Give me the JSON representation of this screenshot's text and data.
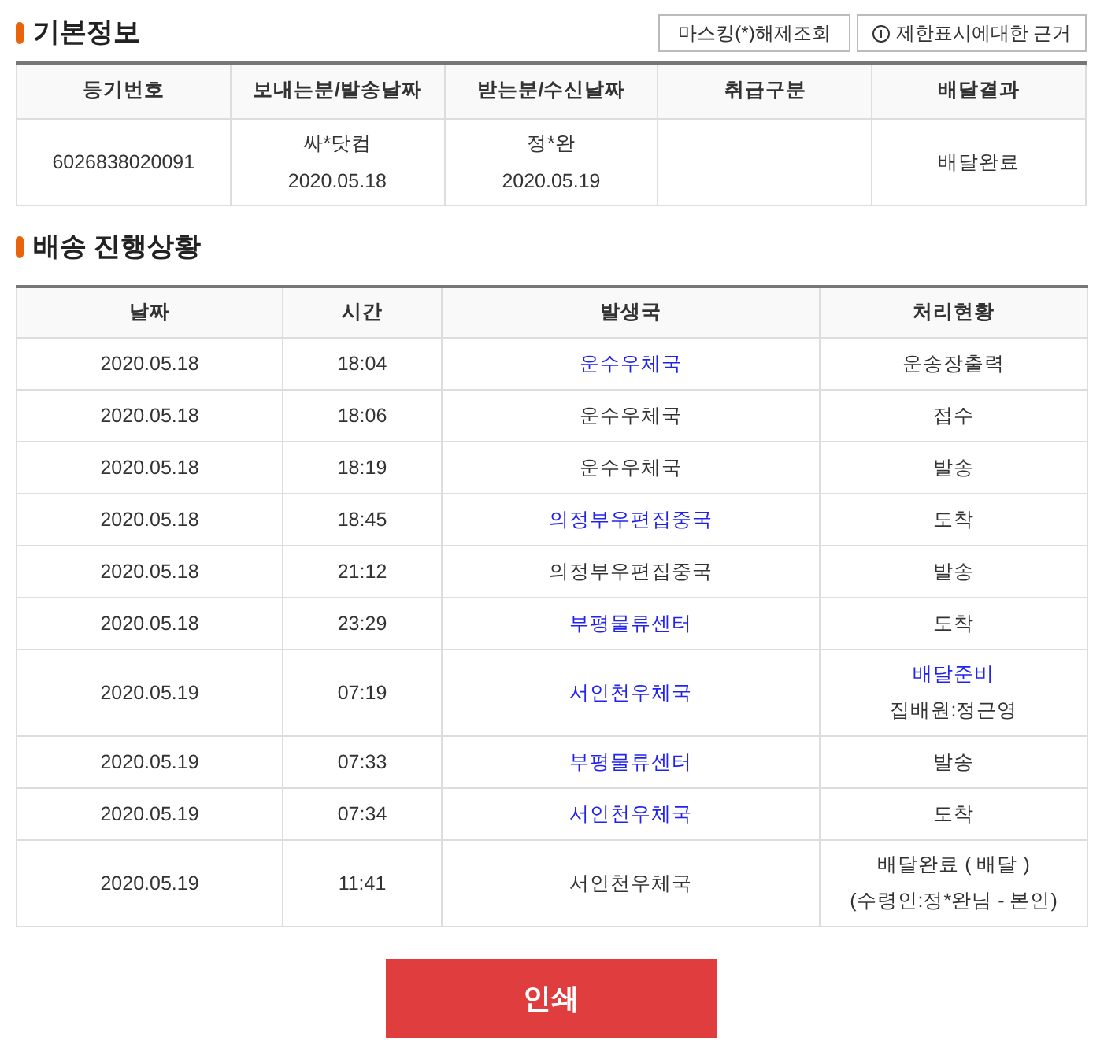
{
  "basic_info": {
    "title": "기본정보",
    "buttons": [
      {
        "label": "마스킹(*)해제조회",
        "icon": false
      },
      {
        "label": "제한표시에대한 근거",
        "icon": true
      }
    ],
    "columns": [
      {
        "header": "등기번호",
        "lines": [
          "6026838020091"
        ]
      },
      {
        "header": "보내는분/발송날짜",
        "lines": [
          "싸*닷컴",
          "2020.05.18"
        ]
      },
      {
        "header": "받는분/수신날짜",
        "lines": [
          "정*완",
          "2020.05.19"
        ]
      },
      {
        "header": "취급구분"
      },
      {
        "header": "배달결과",
        "lines": [
          "배달완료"
        ]
      }
    ]
  },
  "tracking": {
    "title": "배송 진행상황",
    "columns": [
      "날짜",
      "시간",
      "발생국",
      "처리현황"
    ],
    "rows": [
      {
        "date": "2020.05.18",
        "time": "18:04",
        "office": {
          "text": "운수우체국",
          "link": true
        },
        "status": [
          {
            "text": "운송장출력",
            "link": false
          }
        ]
      },
      {
        "date": "2020.05.18",
        "time": "18:06",
        "office": {
          "text": "운수우체국",
          "link": false
        },
        "status": [
          {
            "text": "접수",
            "link": false
          }
        ]
      },
      {
        "date": "2020.05.18",
        "time": "18:19",
        "office": {
          "text": "운수우체국",
          "link": false
        },
        "status": [
          {
            "text": "발송",
            "link": false
          }
        ]
      },
      {
        "date": "2020.05.18",
        "time": "18:45",
        "office": {
          "text": "의정부우편집중국",
          "link": true
        },
        "status": [
          {
            "text": "도착",
            "link": false
          }
        ]
      },
      {
        "date": "2020.05.18",
        "time": "21:12",
        "office": {
          "text": "의정부우편집중국",
          "link": false
        },
        "status": [
          {
            "text": "발송",
            "link": false
          }
        ]
      },
      {
        "date": "2020.05.18",
        "time": "23:29",
        "office": {
          "text": "부평물류센터",
          "link": true
        },
        "status": [
          {
            "text": "도착",
            "link": false
          }
        ]
      },
      {
        "date": "2020.05.19",
        "time": "07:19",
        "office": {
          "text": "서인천우체국",
          "link": true
        },
        "status": [
          {
            "text": "배달준비",
            "link": true
          },
          {
            "text": "집배원:정근영",
            "link": false
          }
        ]
      },
      {
        "date": "2020.05.19",
        "time": "07:33",
        "office": {
          "text": "부평물류센터",
          "link": true
        },
        "status": [
          {
            "text": "발송",
            "link": false
          }
        ]
      },
      {
        "date": "2020.05.19",
        "time": "07:34",
        "office": {
          "text": "서인천우체국",
          "link": true
        },
        "status": [
          {
            "text": "도착",
            "link": false
          }
        ]
      },
      {
        "date": "2020.05.19",
        "time": "11:41",
        "office": {
          "text": "서인천우체국",
          "link": false
        },
        "status": [
          {
            "text": "배달완료 ( 배달 )",
            "link": false
          },
          {
            "text": "(수령인:정*완님 - 본인)",
            "link": false
          }
        ]
      }
    ]
  },
  "print_button": "인쇄"
}
